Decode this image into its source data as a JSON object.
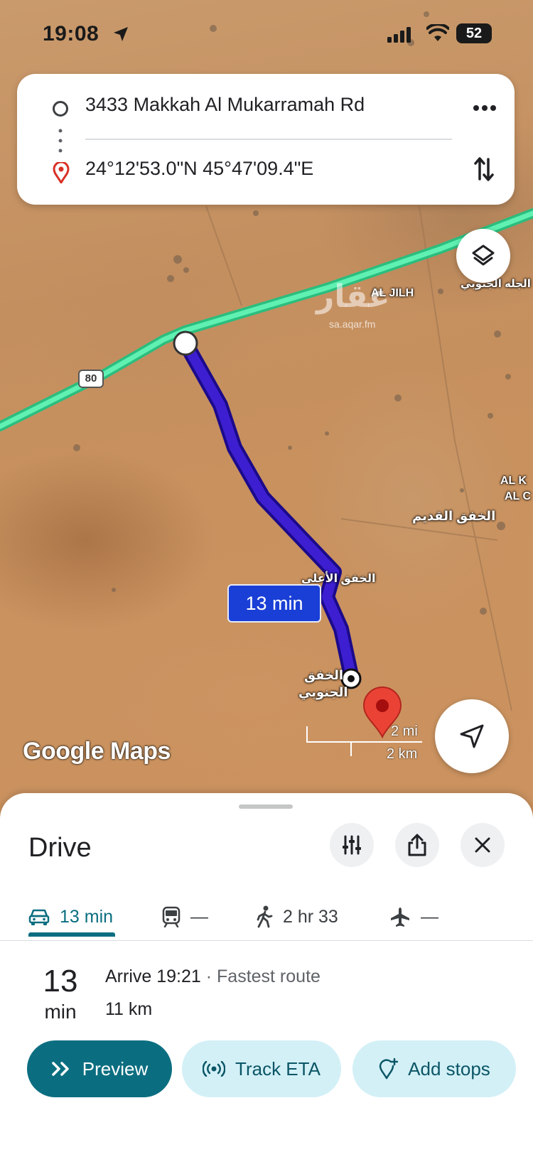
{
  "status_bar": {
    "time": "19:08",
    "battery": "52"
  },
  "route_card": {
    "origin": "3433 Makkah Al Mukarramah Rd",
    "destination": "24°12'53.0\"N 45°47'09.4\"E"
  },
  "map": {
    "route_sign": "80",
    "eta_bubble": "13 min",
    "labels": {
      "al_jilh": "AL JILH",
      "aljilh_south_ar": "الجله الجنوبي",
      "alkhafq_old_ar": "الخفق القديم",
      "al_k": "AL K",
      "al_c": "AL C",
      "alkhafq_south_ar_1": "الخفق",
      "alkhafq_south_ar_2": "الجنوبي",
      "partial_ar": "الخفق الأعلى"
    },
    "watermark": "عقار",
    "watermark_url": "sa.aqar.fm",
    "logo": "Google Maps",
    "scale": {
      "mi": "2 mi",
      "km": "2 km"
    },
    "colors": {
      "route": "#3d1fd1",
      "highway": "#3ddc97"
    }
  },
  "sheet": {
    "title": "Drive",
    "modes": [
      {
        "icon": "car-icon",
        "label": "13 min"
      },
      {
        "icon": "train-icon",
        "label": "—"
      },
      {
        "icon": "walk-icon",
        "label": "2 hr 33"
      },
      {
        "icon": "plane-icon",
        "label": "—"
      }
    ],
    "eta": {
      "num": "13",
      "unit": "min"
    },
    "arrive": "Arrive 19:21",
    "route_note": " · Fastest route",
    "distance": "11 km",
    "buttons": {
      "preview": "Preview",
      "track": "Track ETA",
      "stops": "Add stops"
    },
    "colors": {
      "accent": "#0b6e80",
      "chip": "#d3f0f7"
    }
  }
}
